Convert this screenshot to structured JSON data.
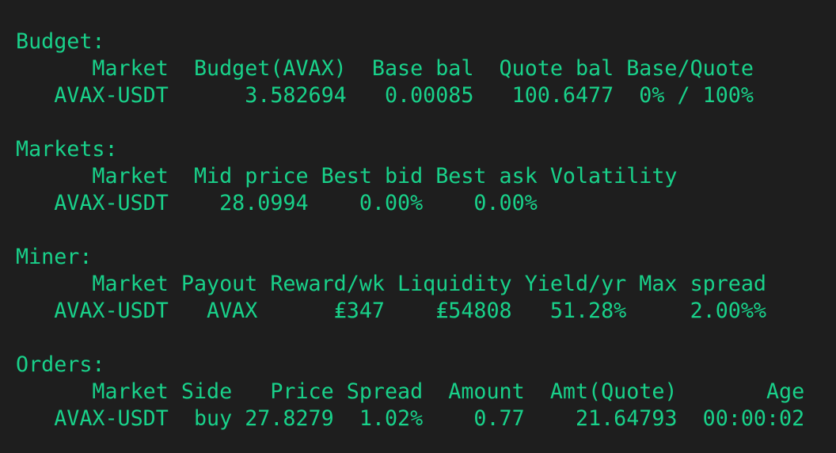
{
  "colors": {
    "background": "#1e1e1e",
    "text": "#19d18a"
  },
  "sections": [
    {
      "title": "Budget:",
      "header": "      Market  Budget(AVAX)  Base bal  Quote bal Base/Quote",
      "rows": [
        "   AVAX-USDT      3.582694   0.00085   100.6477  0% / 100%"
      ]
    },
    {
      "title": "Markets:",
      "header": "      Market  Mid price Best bid Best ask Volatility",
      "rows": [
        "   AVAX-USDT    28.0994    0.00%    0.00%"
      ]
    },
    {
      "title": "Miner:",
      "header": "      Market Payout Reward/wk Liquidity Yield/yr Max spread",
      "rows": [
        "   AVAX-USDT   AVAX      ₤347    ₤54808   51.28%     2.00%%"
      ]
    },
    {
      "title": "Orders:",
      "header": "      Market Side   Price Spread  Amount  Amt(Quote)       Age",
      "rows": [
        "   AVAX-USDT  buy 27.8279  1.02%    0.77    21.64793  00:00:02"
      ]
    }
  ]
}
